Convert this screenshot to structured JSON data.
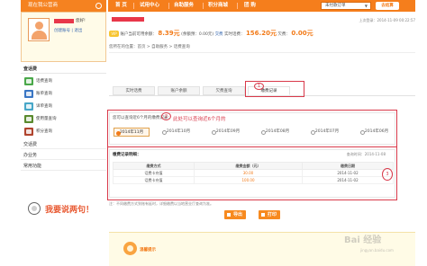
{
  "topbar": {
    "left_title": "现在我公营商",
    "nav": [
      "首 页",
      "试用中心",
      "自助服务",
      "积分商城",
      "团 购"
    ],
    "select_value": "未付款订单",
    "go_label": "去结算"
  },
  "sidebar": {
    "user_tag": "您好!",
    "user_links": "创建账号 | 退出",
    "section_phone": "查话费",
    "items": [
      {
        "label": "话费查询",
        "color": "#4aa84a"
      },
      {
        "label": "账单查询",
        "color": "#3a76c4"
      },
      {
        "label": "详单查询",
        "color": "#48a7c8"
      },
      {
        "label": "使用量查询",
        "color": "#5a8a2e"
      },
      {
        "label": "积分查询",
        "color": "#b0442e"
      }
    ],
    "links": [
      "交话费",
      "办业务",
      "常用功能"
    ],
    "say": "我要说两句！"
  },
  "main": {
    "last_login": "上次登录：2014-11-09 00:22:57",
    "balance": {
      "prefix": "账户当前可用余额：",
      "amount1": "8.39元",
      "mid1": "(余额预：0.00元)",
      "link1": "交费",
      "mid2": "实时话费：",
      "amount2": "156.20元",
      "mid3": "欠费：",
      "amount3": "0.00元"
    },
    "breadcrumb": "您所在的位置：首页 > 自助服务 > 话费查询",
    "tabs": [
      "实时话费",
      "账户余额",
      "欠费查询",
      "缴费记录"
    ],
    "active_tab": 3,
    "months_label": "您可以查询近6个月的缴费记录：",
    "months_note": "此处可以查询近6个月的",
    "months": [
      "2014年11月",
      "2014年10月",
      "2014年09月",
      "2014年08月",
      "2014年07月",
      "2014年06月"
    ],
    "selected_month": 0,
    "records_head": "缴费记录明细：",
    "query_time": "查询时间：2014-11-08",
    "columns": [
      "缴费方式",
      "缴费金额（元）",
      "缴费日期"
    ],
    "rows": [
      {
        "method": "话费卡充值",
        "amount": "30.00",
        "date": "2014-11-02"
      },
      {
        "method": "话费卡充值",
        "amount": "100.00",
        "date": "2014-11-02"
      }
    ],
    "footnote": "注：不同缴费方式到账有延时，详细缴费以当地营业厅查询为准。",
    "export_label": "导出",
    "print_label": "打印",
    "tip_title": "温馨提示",
    "circles": [
      "1",
      "2",
      "3"
    ]
  },
  "watermark": "Bai 经验",
  "watermark_url": "jingyan.baidu.com"
}
